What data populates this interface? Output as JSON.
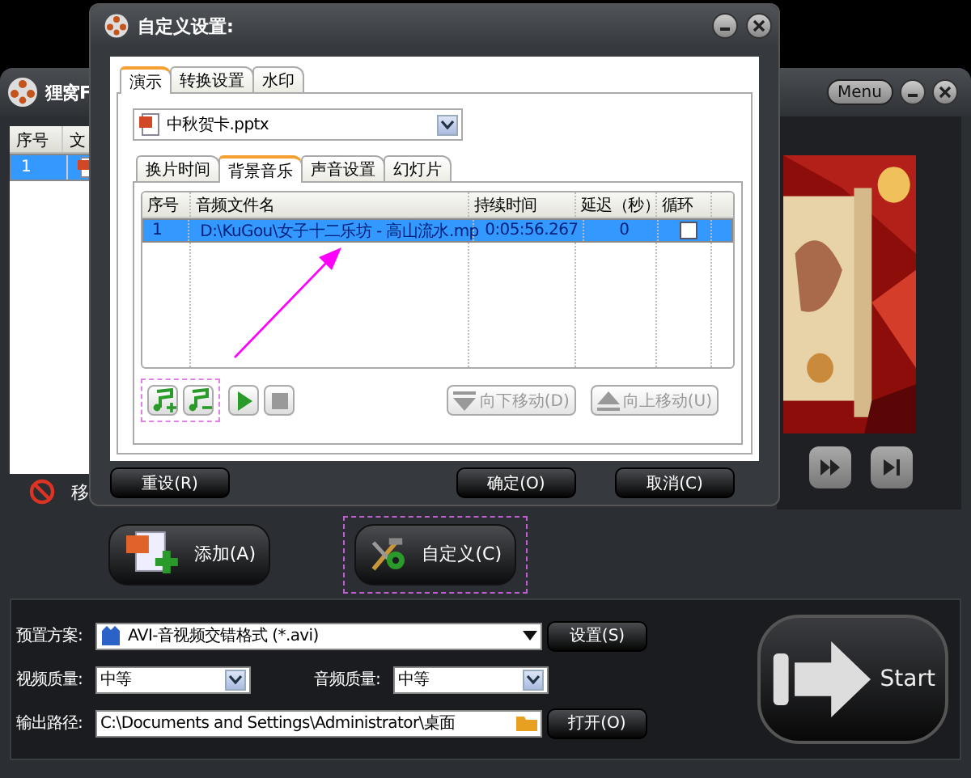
{
  "main_window": {
    "title": "狸窝F",
    "menu_button": "Menu",
    "file_list": {
      "columns": [
        "序号",
        "文"
      ],
      "rows": [
        {
          "index": "1",
          "selected": true
        }
      ]
    },
    "remove_label": "移",
    "buttons": [
      {
        "label": "添加(A)",
        "kind": "add"
      },
      {
        "label": "自定义(C)",
        "kind": "customize",
        "annotated": true
      }
    ]
  },
  "dialog": {
    "title": "自定义设置:",
    "tabs": [
      {
        "label": "演示",
        "selected": true
      },
      {
        "label": "转换设置",
        "selected": false
      },
      {
        "label": "水印",
        "selected": false
      }
    ],
    "file_select": {
      "value": "中秋贺卡.pptx"
    },
    "subtabs": [
      {
        "label": "换片时间",
        "selected": false
      },
      {
        "label": "背景音乐",
        "selected": true
      },
      {
        "label": "声音设置",
        "selected": false
      },
      {
        "label": "幻灯片",
        "selected": false
      }
    ],
    "music_table": {
      "columns": [
        "序号",
        "音频文件名",
        "持续时间",
        "延迟（秒）",
        "循环"
      ],
      "rows": [
        {
          "index": "1",
          "file": "D:\\KuGou\\女子十二乐坊 - 高山流水.mp",
          "duration": "0:05:56.267",
          "delay": "0",
          "loop": false,
          "selected": true
        }
      ]
    },
    "tools_annotated": true,
    "tools": [
      {
        "kind": "add-music"
      },
      {
        "kind": "remove-music"
      },
      {
        "kind": "play"
      },
      {
        "kind": "stop"
      }
    ],
    "move_buttons": [
      {
        "label": "向下移动(D)",
        "kind": "down",
        "disabled": true
      },
      {
        "label": "向上移动(U)",
        "kind": "up",
        "disabled": true
      }
    ],
    "footer_buttons": [
      "重设(R)",
      "确定(O)",
      "取消(C)"
    ]
  },
  "output_settings": {
    "preset": {
      "label": "预置方案:",
      "value": "AVI-音视频交错格式 (*.avi)",
      "button": "设置(S)"
    },
    "video_quality": {
      "label": "视频质量:",
      "value": "中等"
    },
    "audio_quality": {
      "label": "音频质量:",
      "value": "中等"
    },
    "output_path": {
      "label": "输出路径:",
      "value": "C:\\Documents and Settings\\Administrator\\桌面",
      "button": "打开(O)"
    },
    "start_button": "Start"
  }
}
